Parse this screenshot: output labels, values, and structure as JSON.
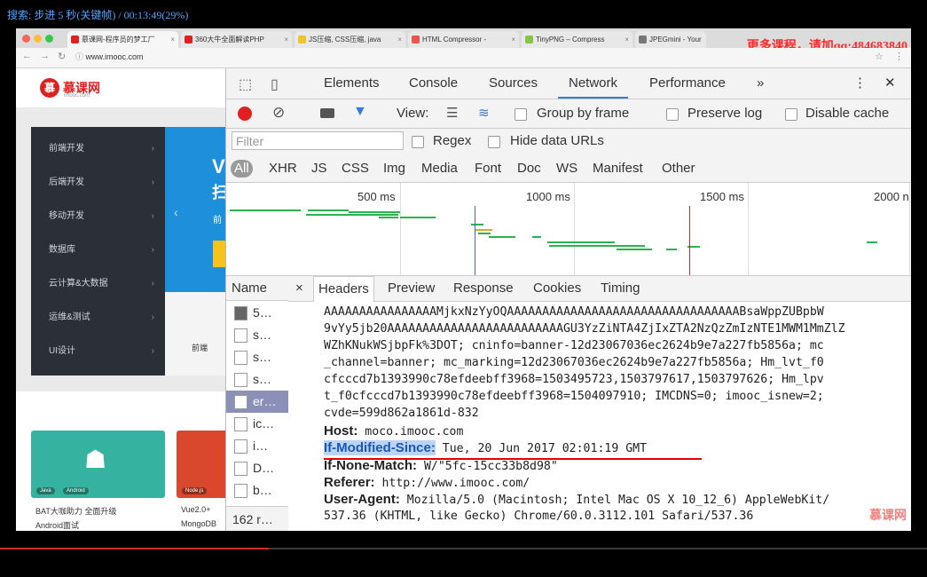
{
  "player": {
    "status": "搜索: 步进 5 秒(关键帧) / 00:13:49(29%)",
    "progress_fraction": 0.29
  },
  "promo": "更多课程，请加qq:484683840",
  "browser": {
    "tabs": [
      {
        "label": "慕课网-程序员的梦工厂",
        "fav_color": "#e02020",
        "active": true
      },
      {
        "label": "360大牛全面解读PHP",
        "fav_color": "#e02020",
        "active": false
      },
      {
        "label": "JS压缩, CSS压缩, java",
        "fav_color": "#f2c12e",
        "active": false
      },
      {
        "label": "HTML Compressor - ",
        "fav_color": "#e8574a",
        "active": false
      },
      {
        "label": "TinyPNG – Compress",
        "fav_color": "#8bc34a",
        "active": false
      },
      {
        "label": "JPEGmini - Your",
        "fav_color": "#777777",
        "active": false
      }
    ],
    "url": "www.imooc.com"
  },
  "site": {
    "logo_text": "慕课网",
    "logo_sub": "imooc.com",
    "categories": [
      "前端开发",
      "后端开发",
      "移动开发",
      "数据库",
      "云计算&大数据",
      "运维&测试",
      "UI设计"
    ],
    "banner_text": "V",
    "banner_text2": "扫",
    "banner_small": "前",
    "banner_bottom": "前端",
    "cards": [
      {
        "tags": [
          "Java",
          "Android"
        ],
        "caption1": "BAT大咖助力 全面升级",
        "caption2": "Android面试"
      },
      {
        "tags": [
          "Node.js"
        ],
        "caption1": "Vue2.0+",
        "caption2": "MongoDB"
      }
    ]
  },
  "devtools": {
    "tabs": [
      "Elements",
      "Console",
      "Sources",
      "Network",
      "Performance"
    ],
    "active_tab": "Network",
    "more": "»",
    "toolbar": {
      "view_label": "View:",
      "group_by_frame": "Group by frame",
      "preserve_log": "Preserve log",
      "disable_cache": "Disable cache"
    },
    "filter_placeholder": "Filter",
    "regex": "Regex",
    "hide_data_urls": "Hide data URLs",
    "types": [
      "All",
      "XHR",
      "JS",
      "CSS",
      "Img",
      "Media",
      "Font",
      "Doc",
      "WS",
      "Manifest",
      "Other"
    ],
    "ticks": [
      "500 ms",
      "1000 ms",
      "1500 ms",
      "2000 n"
    ],
    "requests_header": "Name",
    "requests": [
      "5…",
      "s…",
      "s…",
      "s…",
      "er…",
      "ic…",
      "i…",
      "D…",
      "b…"
    ],
    "selected_request_index": 4,
    "request_count": "162 r…",
    "detail_tabs": [
      "Headers",
      "Preview",
      "Response",
      "Cookies",
      "Timing"
    ],
    "active_detail_tab": "Headers",
    "close_symbol": "×",
    "lines": {
      "l0": "AAAAAAAAAAAAAAAAMjkxNzYyOQAAAAAAAAAAAAAAAAAAAAAAAAAAAAAAAAABsaWppZUBpbW",
      "l1": "9vYy5jb20AAAAAAAAAAAAAAAAAAAAAAAAAGU3YzZiNTA4ZjIxZTA2NzQzZmIzNTE1MWM1MmZlZ",
      "l2": "WZhKNukWSjbpFk%3DOT; cninfo=banner-12d23067036ec2624b9e7a227fb5856a; mc",
      "l3": "_channel=banner; mc_marking=12d23067036ec2624b9e7a227fb5856a; Hm_lvt_f0",
      "l4": "cfcccd7b1393990c78efdeebff3968=1503495723,1503797617,1503797626; Hm_lpv",
      "l5": "t_f0cfcccd7b1393990c78efdeebff3968=1504097910; IMCDNS=0; imooc_isnew=2;",
      "l6": "cvde=599d862a1861d-832"
    },
    "headers": [
      {
        "key": "Host:",
        "value": " moco.imooc.com",
        "highlight": false
      },
      {
        "key": "If-Modified-Since:",
        "value": " Tue, 20 Jun 2017 02:01:19 GMT",
        "highlight": true
      },
      {
        "key": "If-None-Match:",
        "value": " W/\"5fc-15cc33b8d98\"",
        "highlight": false
      },
      {
        "key": "Referer:",
        "value": " http://www.imooc.com/",
        "highlight": false
      },
      {
        "key": "User-Agent:",
        "value": " Mozilla/5.0 (Macintosh; Intel Mac OS X 10_12_6) AppleWebKit/",
        "highlight": false
      }
    ],
    "ua_cont": "537.36 (KHTML, like Gecko) Chrome/60.0.3112.101 Safari/537.36",
    "watermark": "慕课网"
  }
}
